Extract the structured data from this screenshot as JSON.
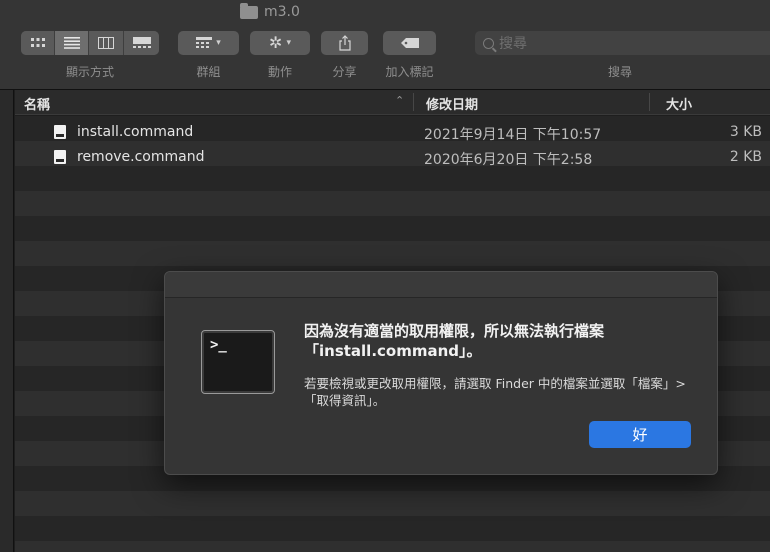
{
  "window": {
    "title": "m3.0"
  },
  "toolbar": {
    "view_label": "顯示方式",
    "group_label": "群組",
    "action_label": "動作",
    "share_label": "分享",
    "tag_label": "加入標記",
    "search_label": "搜尋",
    "search_placeholder": "搜尋"
  },
  "columns": {
    "name": "名稱",
    "modified": "修改日期",
    "size": "大小"
  },
  "files": [
    {
      "name": "install.command",
      "modified": "2021年9月14日 下午10:57",
      "size": "3 KB"
    },
    {
      "name": "remove.command",
      "modified": "2020年6月20日 下午2:58",
      "size": "2 KB"
    }
  ],
  "dialog": {
    "title": "因為沒有適當的取用權限，所以無法執行檔案「install.command」。",
    "message": "若要檢視或更改取用權限，請選取 Finder 中的檔案並選取「檔案」>「取得資訊」。",
    "ok_label": "好",
    "icon_prompt": ">_"
  },
  "colors": {
    "accent": "#2b77e2",
    "window_bg": "#1e1e1e",
    "toolbar_bg": "#353535"
  },
  "icons": [
    "folder-icon",
    "icon-view-icon",
    "list-view-icon",
    "column-view-icon",
    "gallery-view-icon",
    "group-icon",
    "gear-icon",
    "share-icon",
    "tag-icon",
    "search-icon",
    "document-icon",
    "terminal-icon"
  ]
}
